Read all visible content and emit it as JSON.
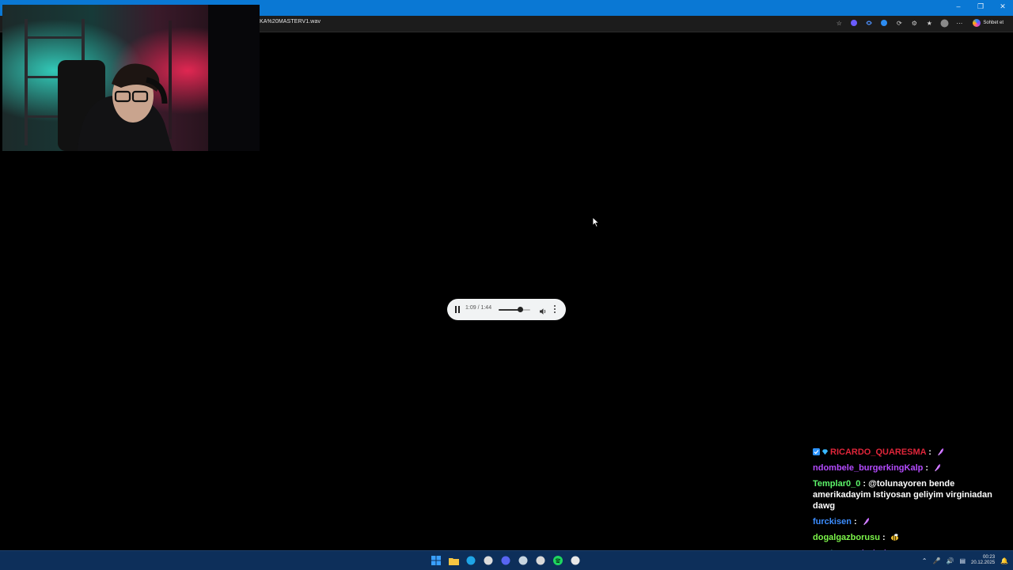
{
  "browser": {
    "url": "KA%20MASTERV1.wav",
    "chat_button_label": "Sohbet et",
    "accent_color": "#0a78d4"
  },
  "player": {
    "time": "1:09 / 1:44",
    "playback_fraction": 0.663,
    "volume_fraction": 0.62,
    "state": "playing"
  },
  "chat": {
    "messages": [
      {
        "user": "RICARDO_QUARESMA",
        "user_color": "#e0253a",
        "separator": ":",
        "text": "",
        "emotes": [
          "purple-feather-emote"
        ],
        "badges": [
          "verified-badge",
          "gem-badge"
        ]
      },
      {
        "user": "ndombele_burgerkingKalp",
        "user_color": "#b54bff",
        "separator": ":",
        "text": "",
        "emotes": [
          "purple-feather-emote"
        ]
      },
      {
        "user": "Templar0_0",
        "user_color": "#5df56a",
        "separator": ":",
        "text": "@tolunayoren bende amerikadayim Istiyosan geliyim virginiadan dawg",
        "emotes": []
      },
      {
        "user": "furckisen",
        "user_color": "#3c8dff",
        "separator": ":",
        "text": "",
        "emotes": [
          "purple-feather-emote"
        ]
      },
      {
        "user": "dogalgazborusu",
        "user_color": "#7cf54a",
        "separator": ":",
        "text": "",
        "emotes": [
          "bee-emote"
        ]
      },
      {
        "user": "mysteer",
        "user_color": "#3fd3b6",
        "separator": ":",
        "text": "",
        "emotes": [
          "purple-feather-emote",
          "purple-feather-emote",
          "purple-feather-emote"
        ]
      }
    ]
  },
  "taskbar": {
    "time": "00:23",
    "date": "20.12.2025",
    "apps": [
      "windows-start-icon",
      "file-explorer-icon",
      "edge-browser-icon",
      "store-icon",
      "discord-icon",
      "steam-icon",
      "obs-icon",
      "spotify-icon",
      "brush-app-icon"
    ]
  }
}
